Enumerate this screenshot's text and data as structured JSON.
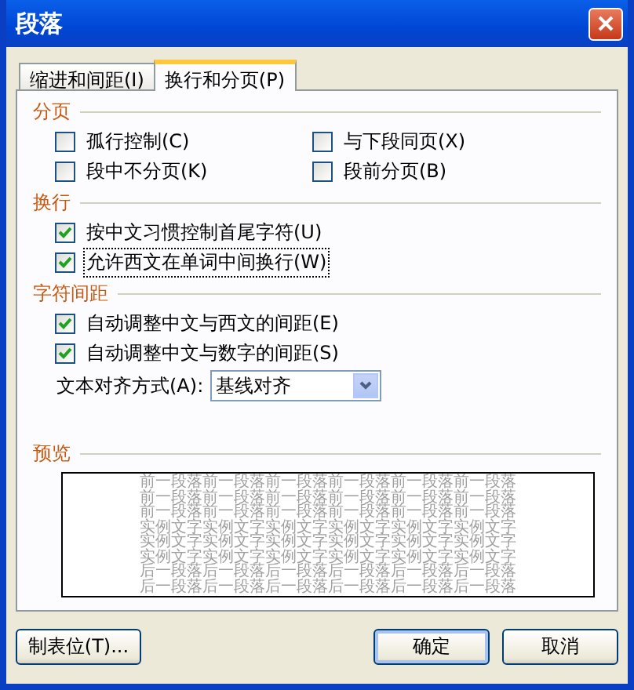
{
  "window": {
    "title": "段落"
  },
  "tabs": [
    {
      "label": "缩进和间距(I)",
      "selected": false
    },
    {
      "label": "换行和分页(P)",
      "selected": true
    }
  ],
  "sections": [
    {
      "title": "分页",
      "kind": "grid",
      "options": [
        {
          "label": "孤行控制(C)",
          "checked": false
        },
        {
          "label": "与下段同页(X)",
          "checked": false
        },
        {
          "label": "段中不分页(K)",
          "checked": false
        },
        {
          "label": "段前分页(B)",
          "checked": false
        }
      ]
    },
    {
      "title": "换行",
      "kind": "list",
      "options": [
        {
          "label": "按中文习惯控制首尾字符(U)",
          "checked": true
        },
        {
          "label": "允许西文在单词中间换行(W)",
          "checked": true,
          "focused": true
        }
      ]
    },
    {
      "title": "字符间距",
      "kind": "list",
      "options": [
        {
          "label": "自动调整中文与西文的间距(E)",
          "checked": true
        },
        {
          "label": "自动调整中文与数字的间距(S)",
          "checked": true
        }
      ],
      "select": {
        "label": "文本对齐方式(A):",
        "value": "基线对齐"
      }
    }
  ],
  "preview": {
    "title": "预览",
    "lines": [
      {
        "text": "前一段落前一段落前一段落前一段落前一段落前一段落"
      },
      {
        "text": "前一段落前一段落前一段落前一段落前一段落前一段落"
      },
      {
        "text": "前一段落前一段落前一段落前一段落前一段落前一段落"
      },
      {
        "text": "实例文字实例文字实例文字实例文字实例文字实例文字"
      },
      {
        "text": "实例文字实例文字实例文字实例文字实例文字实例文字"
      },
      {
        "text": "实例文字实例文字实例文字实例文字实例文字实例文字"
      },
      {
        "text": "后一段落后一段落后一段落后一段落后一段落后一段落"
      },
      {
        "text": "后一段落后一段落后一段落后一段落后一段落后一段落"
      }
    ]
  },
  "buttons": [
    {
      "label": "制表位(T)...",
      "kind": "left"
    },
    {
      "label": "确定",
      "kind": "default"
    },
    {
      "label": "取消",
      "kind": "normal"
    }
  ]
}
